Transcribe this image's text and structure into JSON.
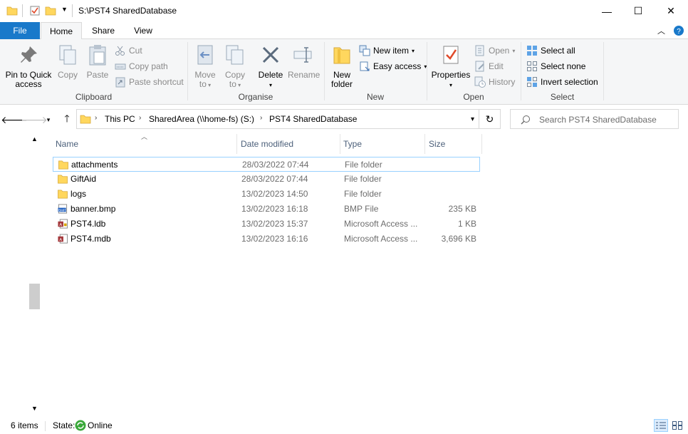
{
  "window": {
    "title": "S:\\PST4 SharedDatabase",
    "minimize": "—",
    "maximize": "☐",
    "close": "✕"
  },
  "tabs": [
    {
      "label": "File"
    },
    {
      "label": "Home"
    },
    {
      "label": "Share"
    },
    {
      "label": "View"
    }
  ],
  "ribbon": {
    "clipboard": {
      "label": "Clipboard",
      "pin_line1": "Pin to Quick",
      "pin_line2": "access",
      "copy": "Copy",
      "paste": "Paste",
      "cut": "Cut",
      "copy_path": "Copy path",
      "paste_shortcut": "Paste shortcut"
    },
    "organise": {
      "label": "Organise",
      "move_to_1": "Move",
      "move_to_2": "to",
      "copy_to_1": "Copy",
      "copy_to_2": "to",
      "delete": "Delete",
      "rename": "Rename"
    },
    "new": {
      "label": "New",
      "new_folder_1": "New",
      "new_folder_2": "folder",
      "new_item": "New item",
      "easy_access": "Easy access"
    },
    "open": {
      "label": "Open",
      "properties": "Properties",
      "open": "Open",
      "edit": "Edit",
      "history": "History"
    },
    "select": {
      "label": "Select",
      "select_all": "Select all",
      "select_none": "Select none",
      "invert": "Invert selection"
    }
  },
  "address": {
    "crumbs": [
      "This PC",
      "SharedArea (\\\\home-fs) (S:)",
      "PST4 SharedDatabase"
    ],
    "search_placeholder": "Search PST4 SharedDatabase"
  },
  "columns": {
    "name": "Name",
    "date": "Date modified",
    "type": "Type",
    "size": "Size"
  },
  "files": [
    {
      "name": "attachments",
      "date": "28/03/2022 07:44",
      "type": "File folder",
      "size": "",
      "icon": "folder-icon"
    },
    {
      "name": "GiftAid",
      "date": "28/03/2022 07:44",
      "type": "File folder",
      "size": "",
      "icon": "folder-icon"
    },
    {
      "name": "logs",
      "date": "13/02/2023 14:50",
      "type": "File folder",
      "size": "",
      "icon": "folder-icon"
    },
    {
      "name": "banner.bmp",
      "date": "13/02/2023 16:18",
      "type": "BMP File",
      "size": "235 KB",
      "icon": "bmp-file-icon"
    },
    {
      "name": "PST4.ldb",
      "date": "13/02/2023 15:37",
      "type": "Microsoft Access ...",
      "size": "1 KB",
      "icon": "access-lock-file-icon"
    },
    {
      "name": "PST4.mdb",
      "date": "13/02/2023 16:16",
      "type": "Microsoft Access ...",
      "size": "3,696 KB",
      "icon": "access-db-file-icon"
    }
  ],
  "status": {
    "items": "6 items",
    "state_label": "State:",
    "state_value": "Online"
  },
  "colors": {
    "file_tab": "#1979ca",
    "folder": "#ffd75e",
    "selection_border": "#99d1ff",
    "online": "#3aa83a"
  }
}
